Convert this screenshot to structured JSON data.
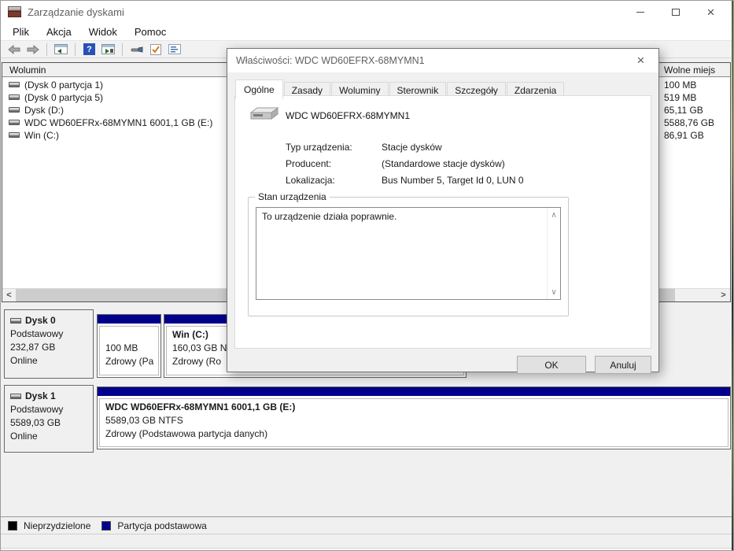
{
  "colors": {
    "primary_partition": "#00008b",
    "unallocated": "#000000",
    "help_icon_bg": "#2850b8",
    "window_bg": "#f0f0f0"
  },
  "window": {
    "title": "Zarządzanie dyskami"
  },
  "menu": {
    "items": [
      "Plik",
      "Akcja",
      "Widok",
      "Pomoc"
    ]
  },
  "toolbar": {
    "icon_names": [
      "back",
      "forward",
      "console-tree",
      "help",
      "show-console",
      "tools",
      "checklist",
      "properties"
    ]
  },
  "icons": {
    "close_glyph": "×",
    "help_glyph": "?",
    "scroll_left_glyph": "<",
    "scroll_right_glyph": ">",
    "scroll_up_glyph": "∧",
    "scroll_down_glyph": "∨"
  },
  "volume_list": {
    "header_volume": "Wolumin",
    "header_free": "Wolne miejs",
    "rows": [
      {
        "name": "(Dysk 0 partycja 1)",
        "free": "100 MB"
      },
      {
        "name": "(Dysk 0 partycja 5)",
        "free": "519 MB"
      },
      {
        "name": "Dysk (D:)",
        "free": "65,11 GB"
      },
      {
        "name": "WDC WD60EFRx-68MYMN1 6001,1 GB (E:)",
        "free": "5588,76 GB"
      },
      {
        "name": "Win (C:)",
        "free": "86,91 GB"
      }
    ]
  },
  "disks": [
    {
      "name": "Dysk 0",
      "type": "Podstawowy",
      "size": "232,87 GB",
      "status": "Online",
      "partitions": [
        {
          "title": "",
          "line1": "100 MB",
          "line2": "Zdrowy (Pa"
        },
        {
          "title": "Win  (C:)",
          "line1": "160,03 GB N",
          "line2": "Zdrowy (Ro"
        }
      ]
    },
    {
      "name": "Dysk 1",
      "type": "Podstawowy",
      "size": "5589,03 GB",
      "status": "Online",
      "partitions": [
        {
          "title": "WDC WD60EFRx-68MYMN1 6001,1 GB  (E:)",
          "line1": "5589,03 GB NTFS",
          "line2": "Zdrowy (Podstawowa partycja danych)"
        }
      ]
    }
  ],
  "legend": {
    "items": [
      {
        "label": "Nieprzydzielone",
        "color": "#000000"
      },
      {
        "label": "Partycja podstawowa",
        "color": "#00008b"
      }
    ]
  },
  "dialog": {
    "title": "Właściwości: WDC WD60EFRX-68MYMN1",
    "tabs": [
      {
        "label": "Ogólne"
      },
      {
        "label": "Zasady"
      },
      {
        "label": "Woluminy"
      },
      {
        "label": "Sterownik"
      },
      {
        "label": "Szczegóły"
      },
      {
        "label": "Zdarzenia"
      }
    ],
    "device_name": "WDC WD60EFRX-68MYMN1",
    "fields": [
      {
        "label": "Typ urządzenia:",
        "value": "Stacje dysków"
      },
      {
        "label": "Producent:",
        "value": "(Standardowe stacje dysków)"
      },
      {
        "label": "Lokalizacja:",
        "value": "Bus Number 5, Target Id 0, LUN 0"
      }
    ],
    "device_status_group": {
      "title": "Stan urządzenia",
      "text": "To urządzenie działa poprawnie."
    },
    "ok_label": "OK",
    "cancel_label": "Anuluj"
  }
}
